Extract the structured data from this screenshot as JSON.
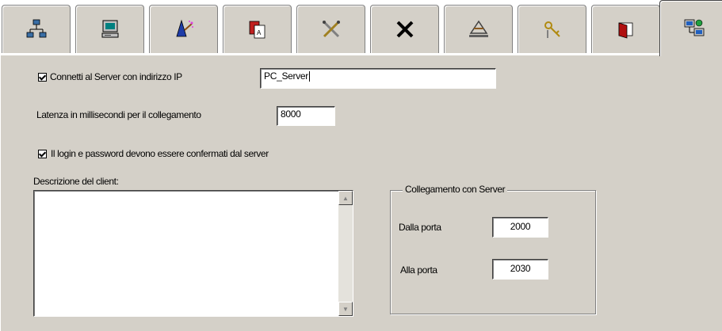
{
  "tabs": [
    {
      "icon": "network-icon"
    },
    {
      "icon": "computer-icon"
    },
    {
      "icon": "wizard-icon"
    },
    {
      "icon": "document-icon"
    },
    {
      "icon": "tools-icon"
    },
    {
      "icon": "close-icon"
    },
    {
      "icon": "hammer-icon"
    },
    {
      "icon": "keys-icon"
    },
    {
      "icon": "book-icon"
    },
    {
      "icon": "network-computers-icon",
      "active": true
    }
  ],
  "form": {
    "connect_checkbox_label": "Connetti al Server con indirizzo IP",
    "connect_checked": true,
    "server_ip_value": "PC_Server",
    "latency_label": "Latenza in millisecondi per il collegamento",
    "latency_value": "8000",
    "login_checkbox_label": "Il login e password devono essere confermati dal server",
    "login_checked": true,
    "description_label": "Descrizione del client:",
    "description_value": ""
  },
  "server_group": {
    "title": "Collegamento con Server",
    "from_port_label": "Dalla porta",
    "from_port_value": "2000",
    "to_port_label": "Alla porta",
    "to_port_value": "2030"
  },
  "colors": {
    "panel_bg": "#d4d0c8",
    "field_bg": "#ffffff"
  }
}
